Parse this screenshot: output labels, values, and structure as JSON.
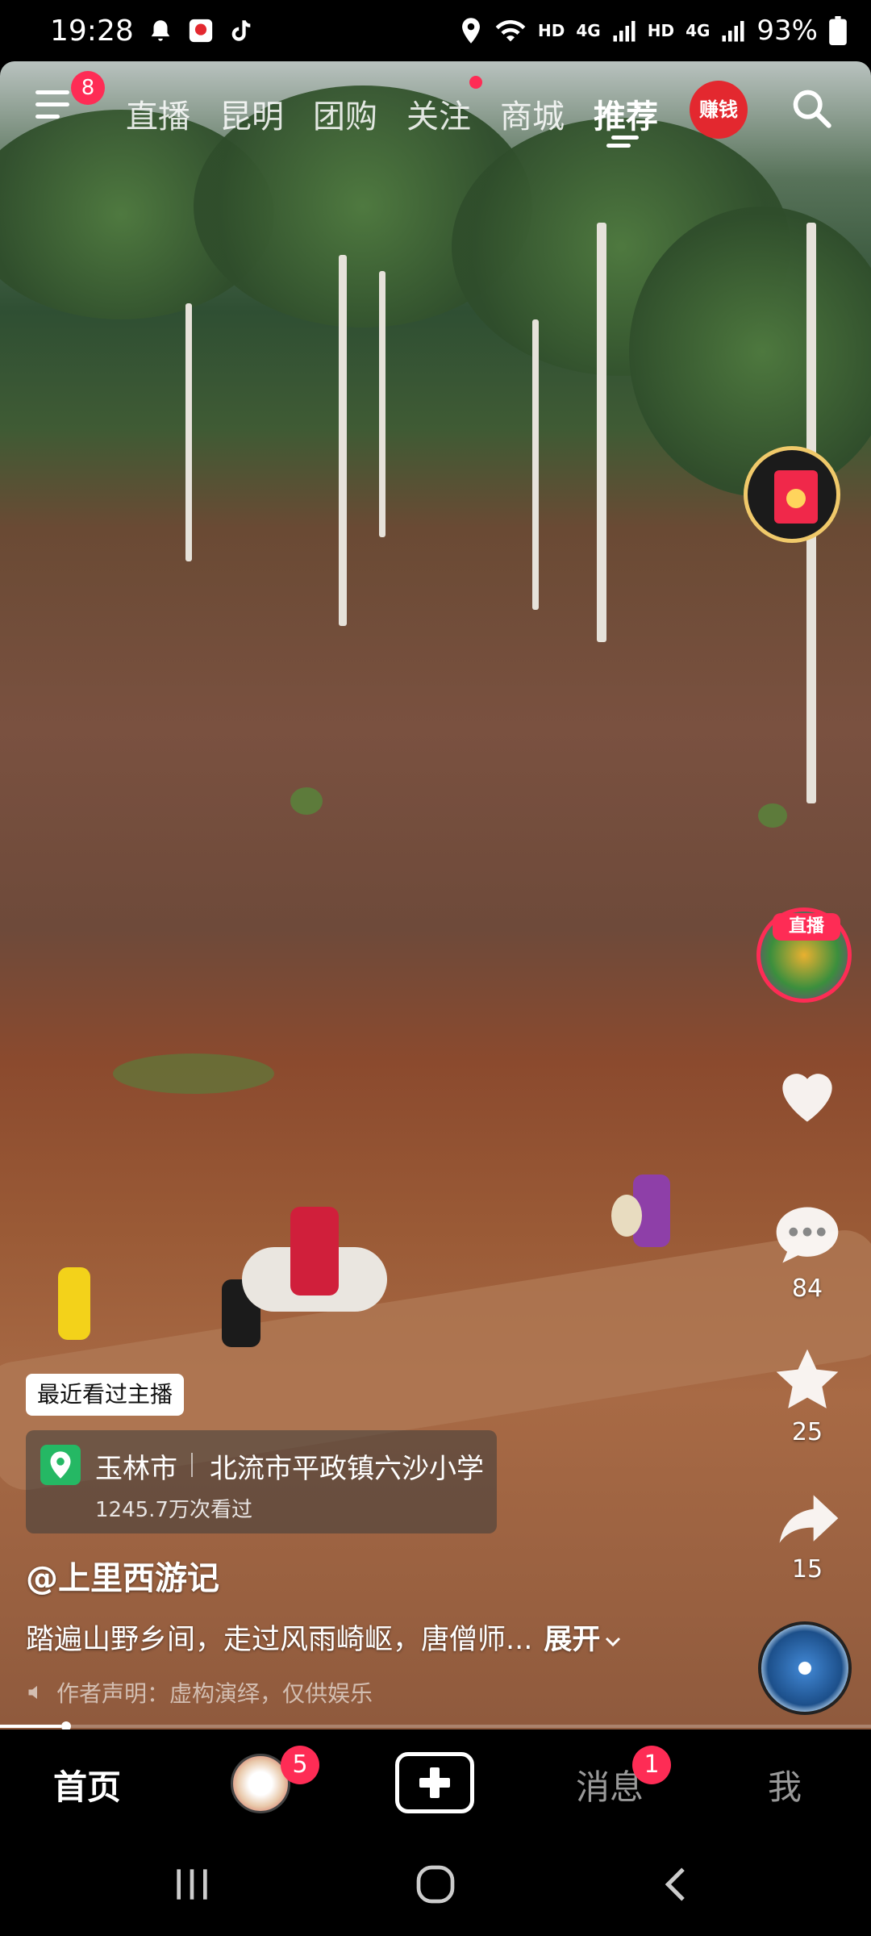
{
  "status": {
    "time": "19:28",
    "hd1": "HD",
    "net1": "4G",
    "hd2": "HD",
    "net2": "4G",
    "battery": "93%"
  },
  "topnav": {
    "menu_badge": "8",
    "tabs": [
      {
        "label": "直播"
      },
      {
        "label": "昆明"
      },
      {
        "label": "团购"
      },
      {
        "label": "关注"
      },
      {
        "label": "商城"
      },
      {
        "label": "推荐"
      }
    ],
    "earn_label": "赚钱"
  },
  "right_rail": {
    "live_label": "直播",
    "comment_count": "84",
    "favorite_count": "25",
    "share_count": "15"
  },
  "info": {
    "recent_chip": "最近看过主播",
    "location_city": "玉林市",
    "location_place": "北流市平政镇六沙小学",
    "location_views": "1245.7万次看过",
    "author": "@上里西游记",
    "caption": "踏遍山野乡间，走过风雨崎岖，唐僧师...",
    "expand": "展开",
    "disclaimer": "作者声明：虚构演绎，仅供娱乐"
  },
  "progress": 0.07,
  "tabbar": {
    "home": "首页",
    "friends_badge": "5",
    "messages": "消息",
    "messages_badge": "1",
    "me": "我"
  },
  "colors": {
    "accent": "#fe2c55",
    "location_green": "#25b864",
    "red_packet_ring": "#f0c96a"
  }
}
